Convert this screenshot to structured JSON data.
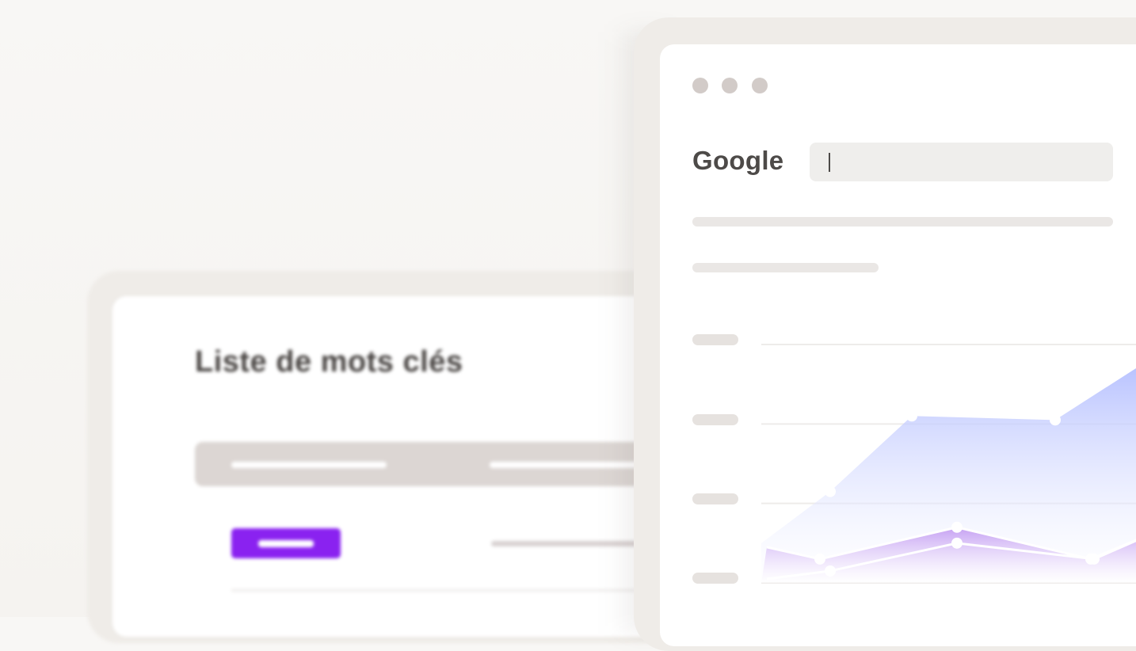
{
  "back_window": {
    "title": "Liste de mots clés"
  },
  "front_window": {
    "brand": "Google",
    "search": {
      "value": ""
    },
    "chart_data": {
      "type": "area",
      "series": [
        {
          "values": [
            1,
            2.3,
            4.2,
            4.1,
            5.9
          ]
        },
        {
          "values": [
            0.1,
            0.3,
            1.0,
            0.6,
            1.4,
            0.6,
            1.2
          ]
        },
        {
          "values": [
            0.9,
            0.6,
            1.4,
            0.6,
            1.4
          ]
        }
      ],
      "grid": true,
      "colors": [
        "#b9c3ff",
        "#c9a9f5",
        "#ffffff"
      ]
    }
  }
}
